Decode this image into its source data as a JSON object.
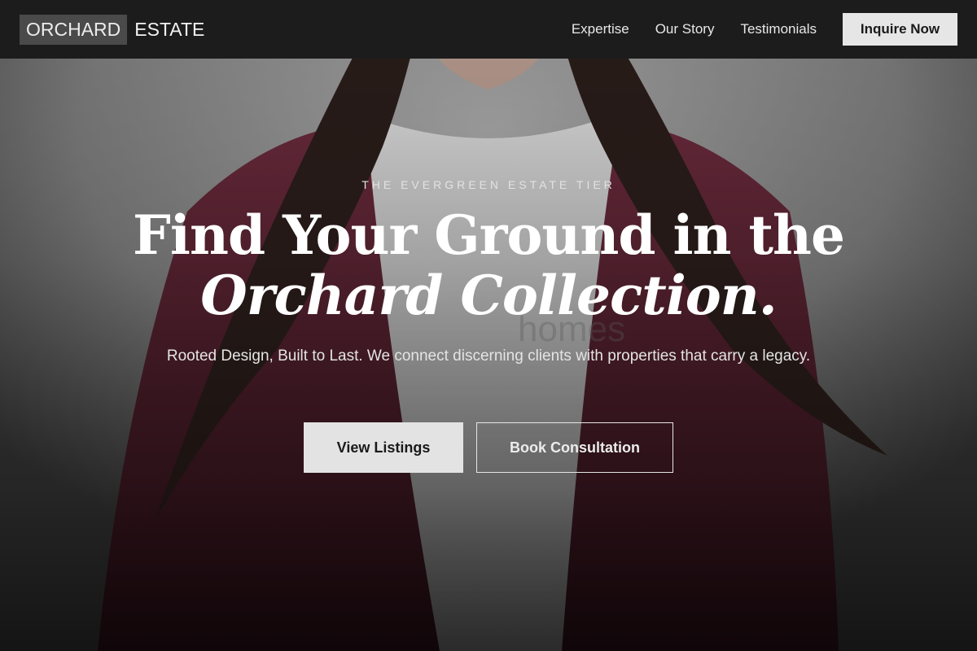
{
  "brand": {
    "name_part1": "ORCHARD",
    "name_part2": "ESTATE"
  },
  "nav": {
    "links": [
      "Expertise",
      "Our Story",
      "Testimonials"
    ],
    "cta_label": "Inquire Now"
  },
  "hero": {
    "eyebrow": "THE EVERGREEN ESTATE TIER",
    "headline_line1": "Find Your Ground in the",
    "headline_line2": "Orchard Collection.",
    "subtitle": "Rooted Design, Built to Last. We connect discerning clients with properties that carry a legacy.",
    "primary_button": "View Listings",
    "secondary_button": "Book Consultation",
    "background_watermark": "homes"
  },
  "colors": {
    "topbar": "#1c1c1c",
    "logo_block": "#4a4a4a",
    "button_light": "#e6e6e6",
    "cardigan": "#5a2233",
    "hair": "#2a1d1a",
    "shirt": "#cfcfcf"
  }
}
